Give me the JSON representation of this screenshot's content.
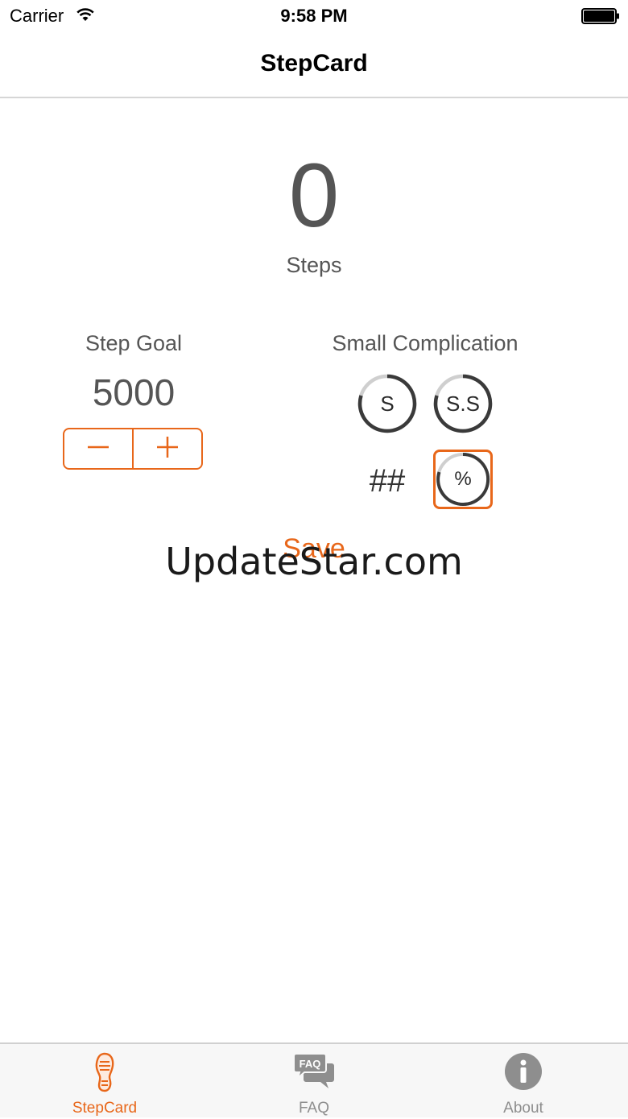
{
  "status_bar": {
    "carrier": "Carrier",
    "time": "9:58 PM"
  },
  "nav": {
    "title": "StepCard"
  },
  "steps": {
    "count": "0",
    "unit": "Steps"
  },
  "goal": {
    "label": "Step Goal",
    "value": "5000",
    "decrement_icon": "minus-icon",
    "increment_icon": "plus-icon"
  },
  "complication": {
    "label": "Small Complication",
    "options": [
      {
        "text": "S",
        "style": "ring"
      },
      {
        "text": "S.S",
        "style": "ring"
      },
      {
        "text": "##",
        "style": "plain"
      },
      {
        "text": "%",
        "style": "ring",
        "selected": true
      }
    ]
  },
  "save_label": "Save",
  "watermark": "UpdateStar.com",
  "tabs": [
    {
      "label": "StepCard",
      "icon": "footprint-icon",
      "active": true
    },
    {
      "label": "FAQ",
      "icon": "faq-bubble-icon",
      "badge": "FAQ",
      "active": false
    },
    {
      "label": "About",
      "icon": "info-icon",
      "active": false
    }
  ],
  "colors": {
    "accent": "#e8671a",
    "text_gray": "#555555",
    "inactive_tab": "#8e8e8e"
  }
}
